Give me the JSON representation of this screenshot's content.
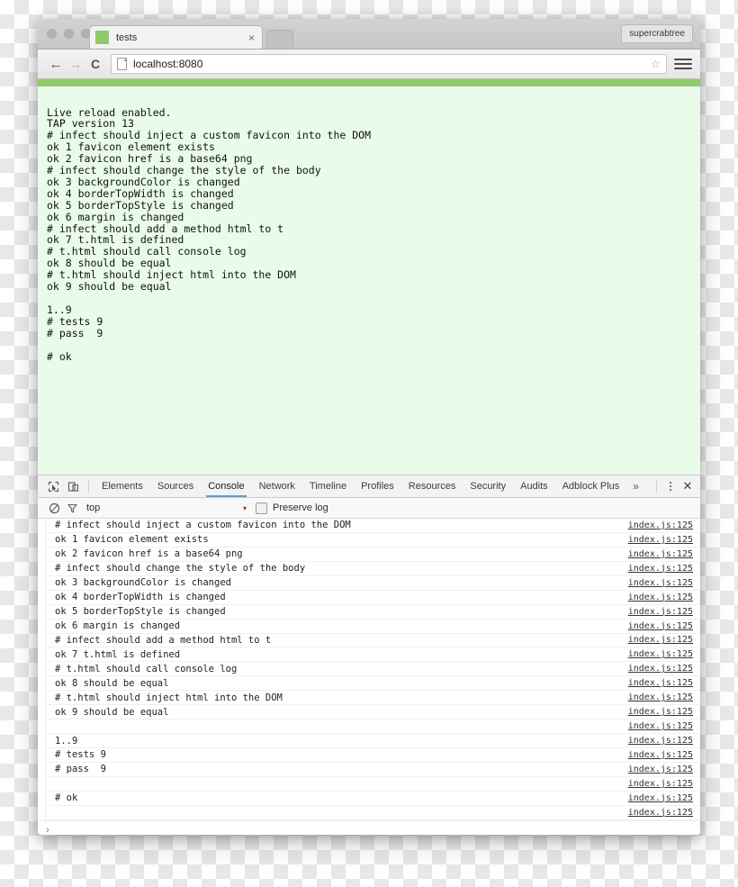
{
  "browser": {
    "profile_label": "supercrabtree",
    "tab": {
      "title": "tests",
      "close_label": "×",
      "favicon_color": "#8ECA6C"
    },
    "nav": {
      "back_icon": "←",
      "forward_icon": "→",
      "reload_icon": "C",
      "url": "localhost:8080",
      "star_icon": "☆"
    }
  },
  "page": {
    "accent_color": "#8ECA6C",
    "background_color": "#E9FCE9",
    "tap_output": "Live reload enabled.\nTAP version 13\n# infect should inject a custom favicon into the DOM\nok 1 favicon element exists\nok 2 favicon href is a base64 png\n# infect should change the style of the body\nok 3 backgroundColor is changed\nok 4 borderTopWidth is changed\nok 5 borderTopStyle is changed\nok 6 margin is changed\n# infect should add a method html to t\nok 7 t.html is defined\n# t.html should call console log\nok 8 should be equal\n# t.html should inject html into the DOM\nok 9 should be equal\n\n1..9\n# tests 9\n# pass  9\n\n# ok"
  },
  "devtools": {
    "tabs": [
      {
        "label": "Elements",
        "active": false
      },
      {
        "label": "Sources",
        "active": false
      },
      {
        "label": "Console",
        "active": true
      },
      {
        "label": "Network",
        "active": false
      },
      {
        "label": "Timeline",
        "active": false
      },
      {
        "label": "Profiles",
        "active": false
      },
      {
        "label": "Resources",
        "active": false
      },
      {
        "label": "Security",
        "active": false
      },
      {
        "label": "Audits",
        "active": false
      },
      {
        "label": "Adblock Plus",
        "active": false
      }
    ],
    "overflow_label": "»",
    "close_label": "✕",
    "active_tab_underline_color": "#5a9fd4",
    "filterbar": {
      "clear_icon": "⊘",
      "filter_icon": "filter-funnel-icon",
      "context": "top",
      "context_caret": "▾",
      "preserve_log_label": "Preserve log",
      "preserve_log_checked": false
    },
    "console": {
      "source_link": "index.js:125",
      "prompt": "›",
      "messages": [
        "# infect should inject a custom favicon into the DOM",
        "ok 1 favicon element exists",
        "ok 2 favicon href is a base64 png",
        "# infect should change the style of the body",
        "ok 3 backgroundColor is changed",
        "ok 4 borderTopWidth is changed",
        "ok 5 borderTopStyle is changed",
        "ok 6 margin is changed",
        "# infect should add a method html to t",
        "ok 7 t.html is defined",
        "# t.html should call console log",
        "ok 8 should be equal",
        "# t.html should inject html into the DOM",
        "ok 9 should be equal",
        "",
        "1..9",
        "# tests 9",
        "# pass  9",
        "",
        "# ok",
        ""
      ]
    }
  }
}
